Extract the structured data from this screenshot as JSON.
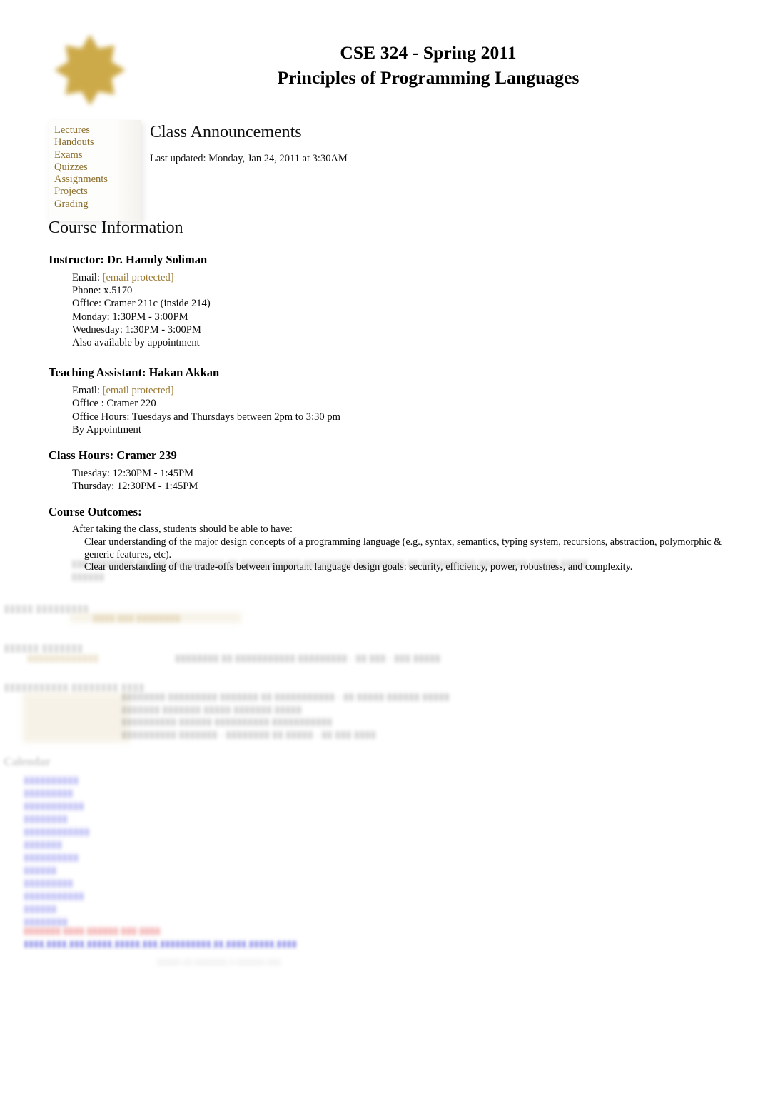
{
  "header": {
    "logo_icon": "sunburst-logo-icon",
    "logo_color": "#c9a33a",
    "title_line1": "CSE 324 - Spring 2011",
    "title_line2": "Principles of Programming Languages"
  },
  "sidebar": {
    "items": [
      {
        "label": "Lectures"
      },
      {
        "label": "Handouts"
      },
      {
        "label": "Exams"
      },
      {
        "label": "Quizzes"
      },
      {
        "label": "Assignments"
      },
      {
        "label": "Projects"
      },
      {
        "label": "Grading"
      }
    ],
    "link_color": "#8a6d2b"
  },
  "announcements": {
    "heading": "Class Announcements",
    "last_updated": "Last updated: Monday, Jan 24, 2011 at 3:30AM"
  },
  "course_information": {
    "heading": "Course Information",
    "instructor": {
      "heading": "Instructor: Dr. Hamdy Soliman",
      "email_label": "Email:",
      "email_value": "[email protected]",
      "lines": [
        "Phone: x.5170",
        "Office: Cramer 211c (inside 214)",
        "Monday: 1:30PM - 3:00PM",
        "Wednesday: 1:30PM - 3:00PM",
        "Also available by appointment"
      ]
    },
    "teaching_assistant": {
      "heading": "Teaching Assistant: Hakan Akkan",
      "email_label": "Email:",
      "email_value": "[email protected]",
      "lines": [
        "Office : Cramer 220",
        "Office Hours: Tuesdays and Thursdays between 2pm to 3:30 pm",
        "By Appointment"
      ]
    },
    "class_hours": {
      "heading": "Class Hours: Cramer 239",
      "lines": [
        "Tuesday: 12:30PM - 1:45PM",
        "Thursday: 12:30PM - 1:45PM"
      ]
    },
    "course_outcomes": {
      "heading": "Course Outcomes:",
      "intro": "After taking the class, students should be able to have:",
      "items": [
        "Clear understanding of the major design concepts of a programming language (e.g., syntax, semantics, typing system, recursions, abstraction, polymorphic & generic features, etc).",
        "Clear understanding of the trade-offs between important language design goals: security, efficiency, power, robustness, and complexity."
      ]
    }
  },
  "faded_region": {
    "note": "Lower portion of the page is rendered faded/blurred and its text is not legible in the screenshot.",
    "calendar_heading": "Calendar",
    "email_link_color": "#9b7a33",
    "blue_link_color": "#3a3ad8",
    "red_text_color": "#e23b3b"
  }
}
